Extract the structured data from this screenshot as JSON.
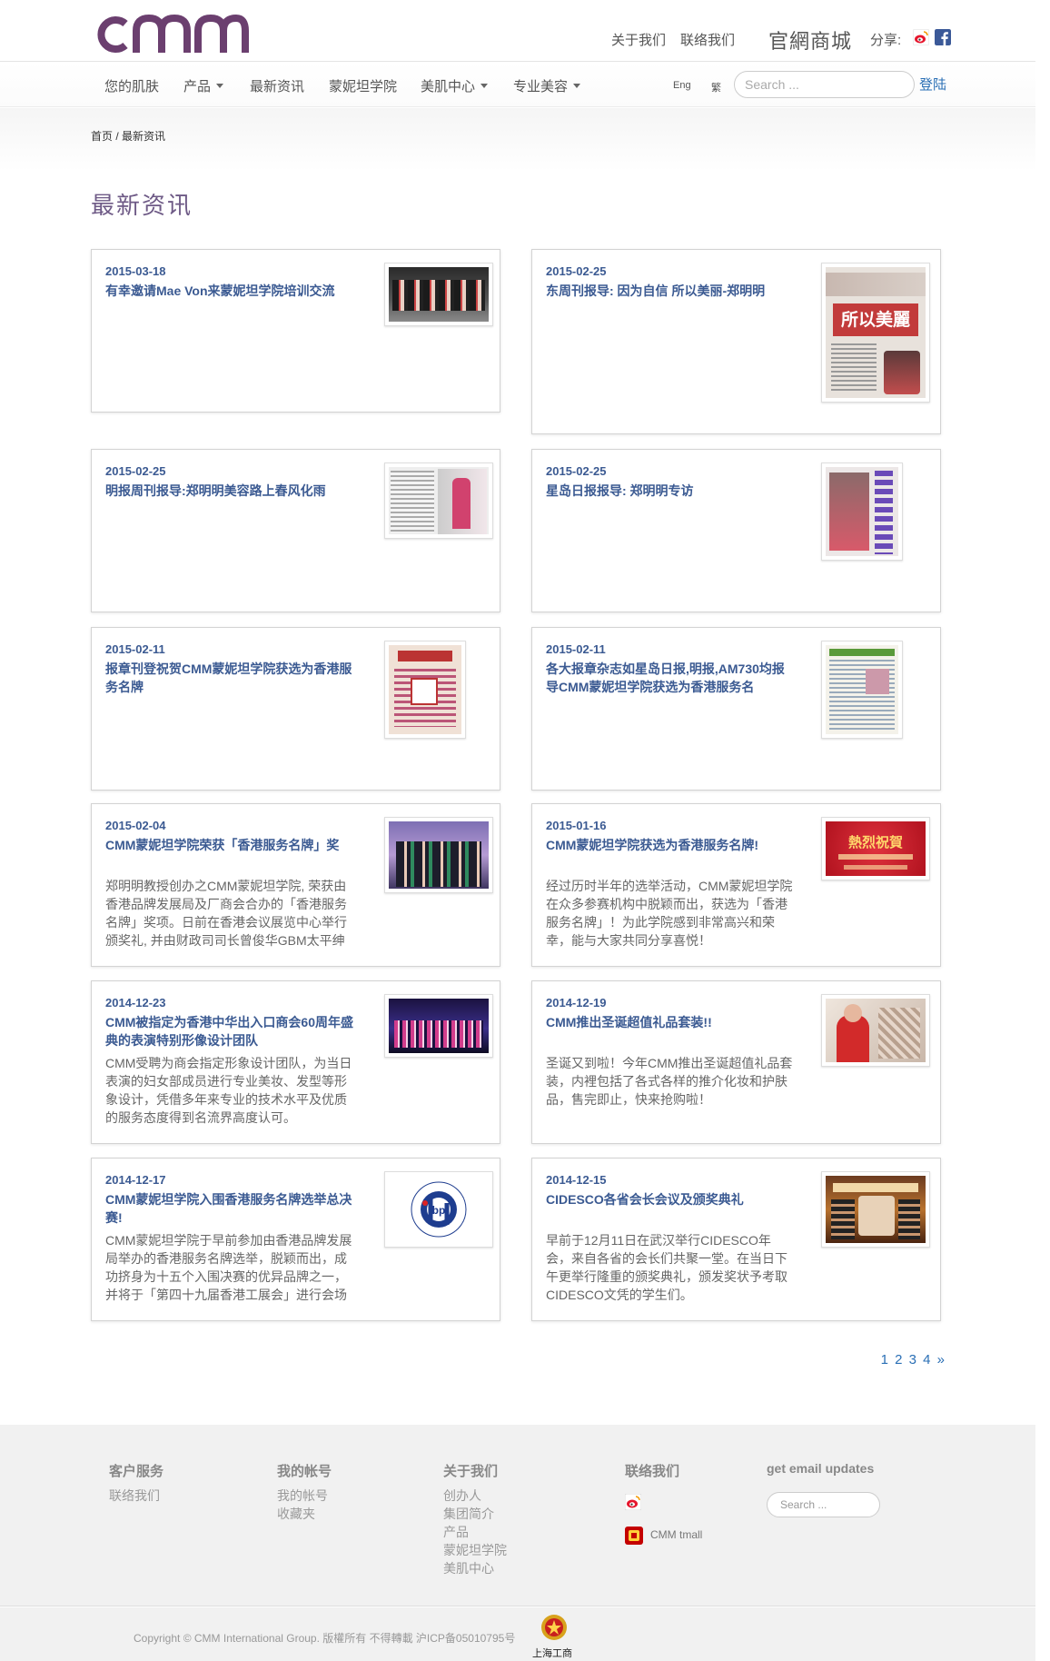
{
  "brand": {
    "logo_text": "cmm",
    "brand_color": "#6b3f6f"
  },
  "header": {
    "about": "关于我们",
    "contact": "联络我们",
    "mall": "官網商城",
    "share_label": "分享:",
    "share_icons": [
      "weibo-icon",
      "facebook-icon"
    ]
  },
  "nav": {
    "items": [
      {
        "label": "您的肌肤",
        "dropdown": false
      },
      {
        "label": "产品",
        "dropdown": true
      },
      {
        "label": "最新资讯",
        "dropdown": false
      },
      {
        "label": "蒙妮坦学院",
        "dropdown": false
      },
      {
        "label": "美肌中心",
        "dropdown": true
      },
      {
        "label": "专业美容",
        "dropdown": true
      }
    ],
    "lang_en": "Eng",
    "lang_tc": "繁",
    "search_placeholder": "Search ...",
    "login": "登陆"
  },
  "breadcrumb": {
    "home": "首页",
    "sep": " / ",
    "current": "最新资讯"
  },
  "page_title": "最新资讯",
  "articles": [
    {
      "date": "2015-03-18",
      "title": "有幸邀请Mae Von来蒙妮坦学院培训交流",
      "excerpt": ""
    },
    {
      "date": "2015-02-25",
      "title": "东周刊报导: 因为自信 所以美丽-郑明明",
      "excerpt": "",
      "thumb_text": "所以美麗"
    },
    {
      "date": "2015-02-25",
      "title": "明报周刊报导:郑明明美容路上春风化雨",
      "excerpt": ""
    },
    {
      "date": "2015-02-25",
      "title": "星岛日报报导: 郑明明专访",
      "excerpt": ""
    },
    {
      "date": "2015-02-11",
      "title": "报章刊登祝贺CMM蒙妮坦学院获选为香港服务名牌",
      "excerpt": ""
    },
    {
      "date": "2015-02-11",
      "title": "各大报章杂志如星岛日报,明报,AM730均报导CMM蒙妮坦学院获选为香港服务名",
      "excerpt": ""
    },
    {
      "date": "2015-02-04",
      "title": "CMM蒙妮坦学院荣获「香港服务名牌」奖",
      "excerpt": "郑明明教授创办之CMM蒙妮坦学院, 荣获由香港品牌发展局及厂商会合办的「香港服务名牌」奖项。日前在香港会议展览中心举行颁奖礼, 并由财政司司长曾俊华GBM太平绅"
    },
    {
      "date": "2015-01-16",
      "title": "CMM蒙妮坦学院获选为香港服务名牌!",
      "excerpt": "经过历时半年的选举活动，CMM蒙妮坦学院在众多参赛机构中脱颖而出，获选为「香港服务名牌」！为此学院感到非常高兴和荣幸，能与大家共同分享喜悦！",
      "thumb_text": "熱烈祝賀"
    },
    {
      "date": "2014-12-23",
      "title": "CMM被指定为香港中华出入口商会60周年盛典的表演特别形像设计团队",
      "excerpt": "CMM受聘为商会指定形象设计团队，为当日表演的妇女部成员进行专业美妆、发型等形象设计，凭借多年来专业的技术水平及优质的服务态度得到名流界高度认可。"
    },
    {
      "date": "2014-12-19",
      "title": "CMM推出圣诞超值礼品套装!!",
      "excerpt": "圣诞又到啦！今年CMM推出圣诞超值礼品套装，内裡包括了各式各样的推介化妆和护肤品，售完即止，快来抢购啦！"
    },
    {
      "date": "2014-12-17",
      "title": "CMM蒙妮坦学院入围香港服务名牌选举总决赛!",
      "excerpt": "CMM蒙妮坦学院于早前参加由香港品牌发展局举办的香港服务名牌选举，脱颖而出，成功挤身为十五个入围决赛的优异品牌之一，并将于「第四十九届香港工展会」进行会场",
      "thumb_text": "bp"
    },
    {
      "date": "2014-12-15",
      "title": "CIDESCO各省会长会议及颁奖典礼",
      "excerpt": "早前于12月11日在武汉举行CIDESCO年会，来自各省的会长们共聚一堂。在当日下午更举行隆重的颁奖典礼，颁发奖状予考取CIDESCO文凭的学生们。"
    }
  ],
  "pagination": {
    "pages": [
      "1",
      "2",
      "3",
      "4"
    ],
    "next": "»"
  },
  "footer": {
    "col1": {
      "heading": "客户服务",
      "links": [
        "联络我们"
      ]
    },
    "col2": {
      "heading": "我的帐号",
      "links": [
        "我的帐号",
        "收藏夹"
      ]
    },
    "col3": {
      "heading": "关于我们",
      "links": [
        "创办人",
        "集团简介",
        "产品",
        "蒙妮坦学院",
        "美肌中心"
      ]
    },
    "col4": {
      "heading": "联络我们",
      "tmall": "CMM tmall"
    },
    "col5": {
      "heading": "get email updates",
      "search_placeholder": "Search ..."
    },
    "copyright": "Copyright © CMM International Group. 版權所有 不得轉載 沪ICP备05010795号",
    "badge_text": "上海工商"
  },
  "colors": {
    "title": "#6e5a86",
    "link": "#3b5a92",
    "accent_blue": "#2a6fb5"
  }
}
